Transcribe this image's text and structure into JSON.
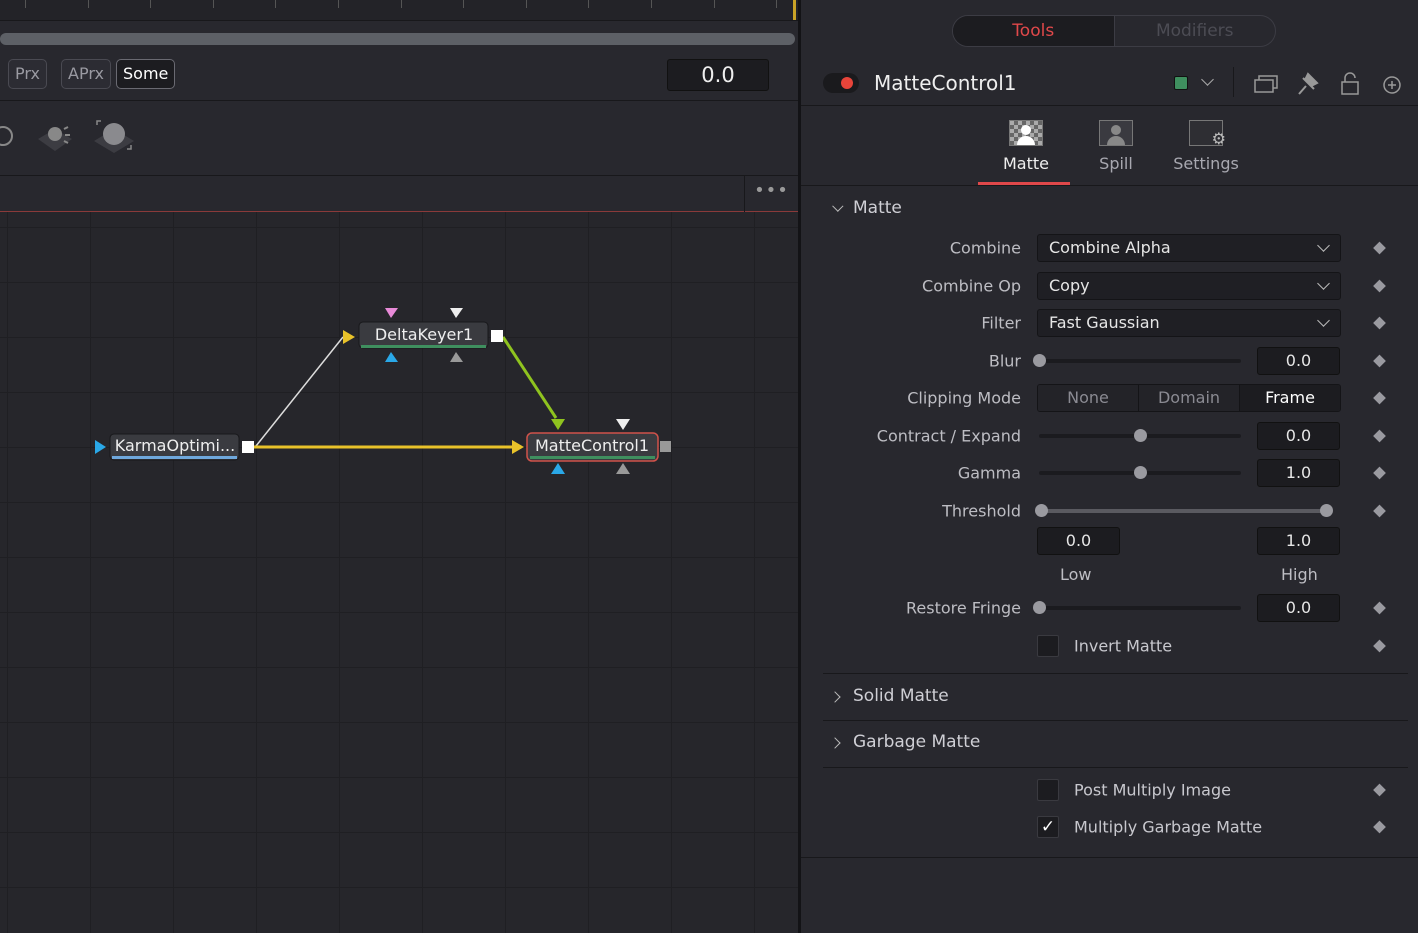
{
  "timeline": {
    "proxy_buttons": [
      {
        "label": "Prx",
        "active": false
      },
      {
        "label": "APrx",
        "active": false
      },
      {
        "label": "Some",
        "active": true
      }
    ],
    "time_value": "0.0"
  },
  "node_editor": {
    "more_label": "•••",
    "nodes": [
      {
        "name": "KarmaOptimi...",
        "bar_color": "#6fa8dc"
      },
      {
        "name": "DeltaKeyer1",
        "bar_color": "#3f8f5f"
      },
      {
        "name": "MatteControl1",
        "bar_color": "#3f8f5f",
        "selected": true
      }
    ],
    "connection_colors": {
      "white": "#dddddd",
      "yellow": "#e8c22a",
      "green": "#8fc31f"
    }
  },
  "inspector": {
    "top_tabs": [
      {
        "label": "Tools",
        "active": true
      },
      {
        "label": "Modifiers",
        "active": false
      }
    ],
    "tool_name": "MatteControl1",
    "tool_color": "#3f8f5f",
    "header_icons": [
      "toggle-icon",
      "color-swatch-icon",
      "chevron-down-icon",
      "windows-icon",
      "pin-icon",
      "lock-icon",
      "reset-icon"
    ],
    "tabs": [
      {
        "label": "Matte",
        "active": true
      },
      {
        "label": "Spill",
        "active": false
      },
      {
        "label": "Settings",
        "active": false
      }
    ],
    "accent": "#e0484a",
    "section_matte": "Matte",
    "combine": {
      "label": "Combine",
      "value": "Combine Alpha"
    },
    "combine_op": {
      "label": "Combine Op",
      "value": "Copy"
    },
    "filter": {
      "label": "Filter",
      "value": "Fast Gaussian"
    },
    "blur": {
      "label": "Blur",
      "value": "0.0",
      "slider": 0.0
    },
    "clipping_mode": {
      "label": "Clipping Mode",
      "options": [
        "None",
        "Domain",
        "Frame"
      ],
      "selected": "Frame"
    },
    "contract_expand": {
      "label": "Contract / Expand",
      "value": "0.0",
      "slider": 0.5
    },
    "gamma": {
      "label": "Gamma",
      "value": "1.0",
      "slider": 0.5
    },
    "threshold": {
      "label": "Threshold",
      "low": "0.0",
      "high": "1.0",
      "low_label": "Low",
      "high_label": "High"
    },
    "restore_fringe": {
      "label": "Restore Fringe",
      "value": "0.0",
      "slider": 0.0
    },
    "invert_matte": {
      "label": "Invert Matte",
      "checked": false
    },
    "section_solid": "Solid Matte",
    "section_garbage": "Garbage Matte",
    "post_multiply": {
      "label": "Post Multiply Image",
      "checked": false
    },
    "multiply_garbage": {
      "label": "Multiply Garbage Matte",
      "checked": true,
      "mark": "✓"
    }
  }
}
